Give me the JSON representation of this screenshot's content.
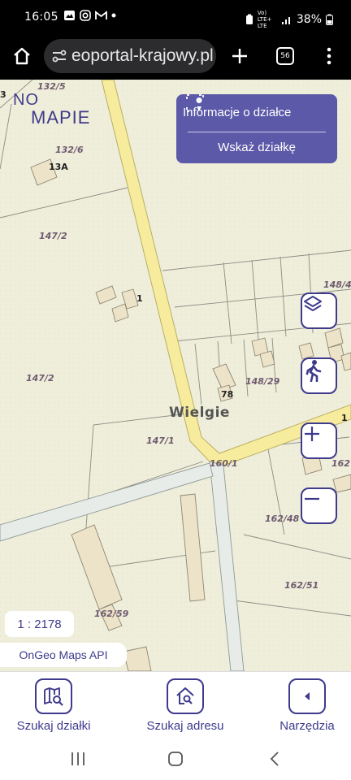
{
  "status_bar": {
    "time": "16:05",
    "signal_text": "Vo) LTE+ LTE",
    "battery": "38%"
  },
  "browser": {
    "url": "eoportal-krajowy.pl",
    "tab_count": "56"
  },
  "map": {
    "logo": {
      "line1": "NO",
      "line2": "MAPIE"
    },
    "info_panel": {
      "title": "Informacje o działce",
      "action": "Wskaż działkę"
    },
    "labels": {
      "plot_132_5": "132/5",
      "plot_132_6": "132/6",
      "bldg_13a": "13A",
      "plot_147_2_a": "147/2",
      "plot_147_2_b": "147/2",
      "plot_148_4": "148/4",
      "bldg_1": "1",
      "plot_148_29": "148/29",
      "bldg_78": "78",
      "place": "Wielgie",
      "plot_147_1": "147/1",
      "plot_160_1": "160/1",
      "plot_162_a": "162",
      "plot_162_48": "162/48",
      "plot_162_51": "162/51",
      "plot_162_59": "162/59",
      "edge_3": "3",
      "edge_1": "1"
    },
    "scale": "1 : 2178",
    "credit": "OnGeo Maps API"
  },
  "bottom_nav": {
    "items": [
      {
        "label": "Szukaj działki",
        "icon": "map-search-icon"
      },
      {
        "label": "Szukaj adresu",
        "icon": "home-search-icon"
      },
      {
        "label": "Narzędzia",
        "icon": "chevron-left-icon"
      }
    ]
  },
  "colors": {
    "accent": "#3e3a8c",
    "panel": "#5b59a8",
    "road": "#f7ec9e",
    "map_bg": "#efeeda"
  }
}
